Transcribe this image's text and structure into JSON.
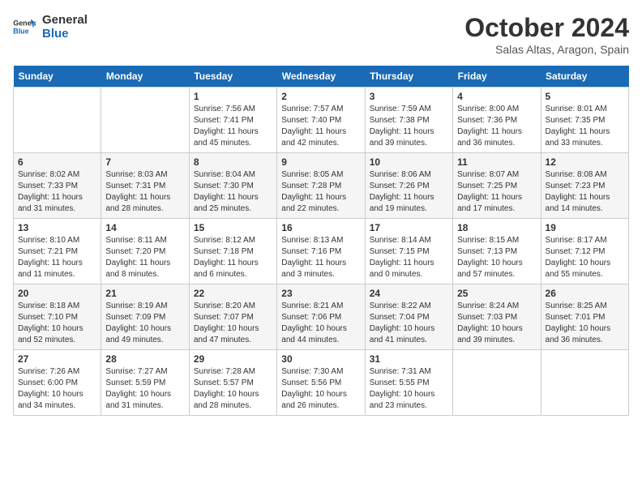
{
  "logo": {
    "line1": "General",
    "line2": "Blue"
  },
  "title": "October 2024",
  "location": "Salas Altas, Aragon, Spain",
  "days_of_week": [
    "Sunday",
    "Monday",
    "Tuesday",
    "Wednesday",
    "Thursday",
    "Friday",
    "Saturday"
  ],
  "weeks": [
    [
      {
        "day": null,
        "detail": null
      },
      {
        "day": null,
        "detail": null
      },
      {
        "day": "1",
        "detail": "Sunrise: 7:56 AM\nSunset: 7:41 PM\nDaylight: 11 hours and 45 minutes."
      },
      {
        "day": "2",
        "detail": "Sunrise: 7:57 AM\nSunset: 7:40 PM\nDaylight: 11 hours and 42 minutes."
      },
      {
        "day": "3",
        "detail": "Sunrise: 7:59 AM\nSunset: 7:38 PM\nDaylight: 11 hours and 39 minutes."
      },
      {
        "day": "4",
        "detail": "Sunrise: 8:00 AM\nSunset: 7:36 PM\nDaylight: 11 hours and 36 minutes."
      },
      {
        "day": "5",
        "detail": "Sunrise: 8:01 AM\nSunset: 7:35 PM\nDaylight: 11 hours and 33 minutes."
      }
    ],
    [
      {
        "day": "6",
        "detail": "Sunrise: 8:02 AM\nSunset: 7:33 PM\nDaylight: 11 hours and 31 minutes."
      },
      {
        "day": "7",
        "detail": "Sunrise: 8:03 AM\nSunset: 7:31 PM\nDaylight: 11 hours and 28 minutes."
      },
      {
        "day": "8",
        "detail": "Sunrise: 8:04 AM\nSunset: 7:30 PM\nDaylight: 11 hours and 25 minutes."
      },
      {
        "day": "9",
        "detail": "Sunrise: 8:05 AM\nSunset: 7:28 PM\nDaylight: 11 hours and 22 minutes."
      },
      {
        "day": "10",
        "detail": "Sunrise: 8:06 AM\nSunset: 7:26 PM\nDaylight: 11 hours and 19 minutes."
      },
      {
        "day": "11",
        "detail": "Sunrise: 8:07 AM\nSunset: 7:25 PM\nDaylight: 11 hours and 17 minutes."
      },
      {
        "day": "12",
        "detail": "Sunrise: 8:08 AM\nSunset: 7:23 PM\nDaylight: 11 hours and 14 minutes."
      }
    ],
    [
      {
        "day": "13",
        "detail": "Sunrise: 8:10 AM\nSunset: 7:21 PM\nDaylight: 11 hours and 11 minutes."
      },
      {
        "day": "14",
        "detail": "Sunrise: 8:11 AM\nSunset: 7:20 PM\nDaylight: 11 hours and 8 minutes."
      },
      {
        "day": "15",
        "detail": "Sunrise: 8:12 AM\nSunset: 7:18 PM\nDaylight: 11 hours and 6 minutes."
      },
      {
        "day": "16",
        "detail": "Sunrise: 8:13 AM\nSunset: 7:16 PM\nDaylight: 11 hours and 3 minutes."
      },
      {
        "day": "17",
        "detail": "Sunrise: 8:14 AM\nSunset: 7:15 PM\nDaylight: 11 hours and 0 minutes."
      },
      {
        "day": "18",
        "detail": "Sunrise: 8:15 AM\nSunset: 7:13 PM\nDaylight: 10 hours and 57 minutes."
      },
      {
        "day": "19",
        "detail": "Sunrise: 8:17 AM\nSunset: 7:12 PM\nDaylight: 10 hours and 55 minutes."
      }
    ],
    [
      {
        "day": "20",
        "detail": "Sunrise: 8:18 AM\nSunset: 7:10 PM\nDaylight: 10 hours and 52 minutes."
      },
      {
        "day": "21",
        "detail": "Sunrise: 8:19 AM\nSunset: 7:09 PM\nDaylight: 10 hours and 49 minutes."
      },
      {
        "day": "22",
        "detail": "Sunrise: 8:20 AM\nSunset: 7:07 PM\nDaylight: 10 hours and 47 minutes."
      },
      {
        "day": "23",
        "detail": "Sunrise: 8:21 AM\nSunset: 7:06 PM\nDaylight: 10 hours and 44 minutes."
      },
      {
        "day": "24",
        "detail": "Sunrise: 8:22 AM\nSunset: 7:04 PM\nDaylight: 10 hours and 41 minutes."
      },
      {
        "day": "25",
        "detail": "Sunrise: 8:24 AM\nSunset: 7:03 PM\nDaylight: 10 hours and 39 minutes."
      },
      {
        "day": "26",
        "detail": "Sunrise: 8:25 AM\nSunset: 7:01 PM\nDaylight: 10 hours and 36 minutes."
      }
    ],
    [
      {
        "day": "27",
        "detail": "Sunrise: 7:26 AM\nSunset: 6:00 PM\nDaylight: 10 hours and 34 minutes."
      },
      {
        "day": "28",
        "detail": "Sunrise: 7:27 AM\nSunset: 5:59 PM\nDaylight: 10 hours and 31 minutes."
      },
      {
        "day": "29",
        "detail": "Sunrise: 7:28 AM\nSunset: 5:57 PM\nDaylight: 10 hours and 28 minutes."
      },
      {
        "day": "30",
        "detail": "Sunrise: 7:30 AM\nSunset: 5:56 PM\nDaylight: 10 hours and 26 minutes."
      },
      {
        "day": "31",
        "detail": "Sunrise: 7:31 AM\nSunset: 5:55 PM\nDaylight: 10 hours and 23 minutes."
      },
      {
        "day": null,
        "detail": null
      },
      {
        "day": null,
        "detail": null
      }
    ]
  ]
}
